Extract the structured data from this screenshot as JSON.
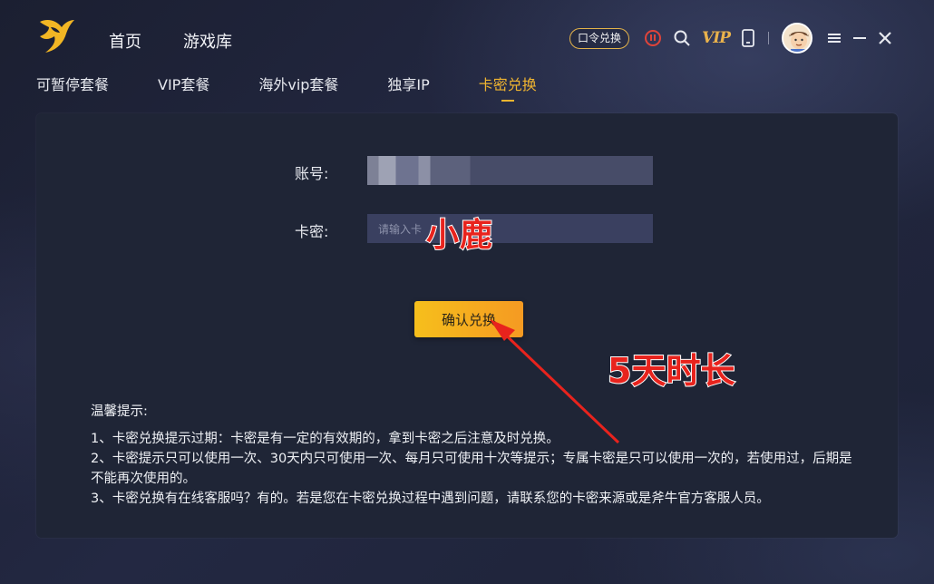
{
  "header": {
    "nav": [
      "首页",
      "游戏库"
    ],
    "voucher_label": "口令兑换",
    "vip_label": "VIP",
    "icons": [
      "power-icon",
      "search-icon",
      "vip-icon",
      "phone-icon",
      "menu-icon",
      "minimize-icon",
      "close-icon"
    ]
  },
  "subnav": {
    "tabs": [
      "可暂停套餐",
      "VIP套餐",
      "海外vip套餐",
      "独享IP",
      "卡密兑换"
    ],
    "active_index": 4
  },
  "form": {
    "account_label": "账号:",
    "card_label": "卡密:",
    "card_placeholder": "请输入卡",
    "confirm_label": "确认兑换"
  },
  "tips": {
    "title": "温馨提示:",
    "items": [
      "1、卡密兑换提示过期：卡密是有一定的有效期的，拿到卡密之后注意及时兑换。",
      "2、卡密提示只可以使用一次、30天内只可使用一次、每月只可使用十次等提示；专属卡密是只可以使用一次的，若使用过，后期是不能再次使用的。",
      "3、卡密兑换有在线客服吗？有的。若是您在卡密兑换过程中遇到问题，请联系您的卡密来源或是斧牛官方客服人员。"
    ]
  },
  "annotations": {
    "label_1": "小鹿",
    "label_2": "5天时长"
  },
  "colors": {
    "accent": "#f0b530",
    "annotation_red": "#e8231d",
    "panel_bg": "#1f2536"
  }
}
